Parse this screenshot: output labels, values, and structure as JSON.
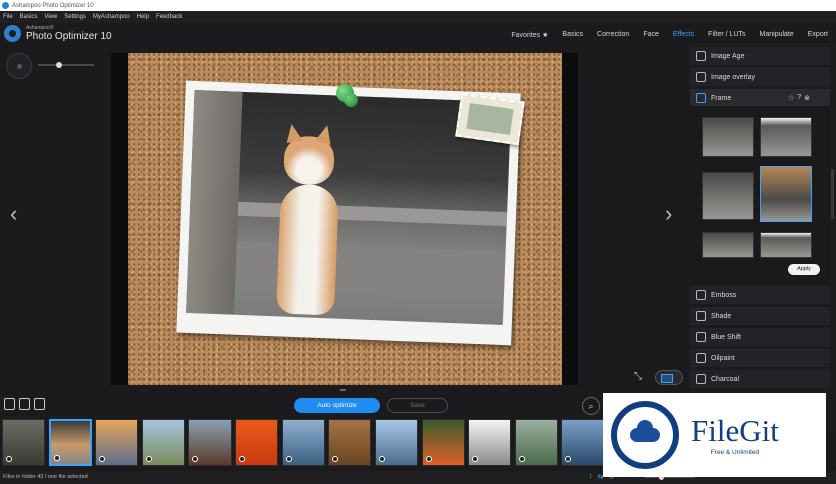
{
  "window": {
    "title": "Ashampoo Photo Optimizer 10"
  },
  "menu": [
    "File",
    "Basics",
    "View",
    "Settings",
    "MyAshampoo",
    "Help",
    "Feedback"
  ],
  "logo": {
    "brand": "Ashampoo®",
    "product": "Photo Optimizer 10"
  },
  "nav": {
    "items": [
      "Favorites ★",
      "Basics",
      "Correction",
      "Face",
      "Effects",
      "Filter / LUTs",
      "Manipulate",
      "Export"
    ],
    "active": "Effects"
  },
  "effects_panel": {
    "items_top": [
      "Image Age",
      "Image overlay"
    ],
    "selected": "Frame",
    "frame_actions": [
      "☆",
      "?",
      "⊗"
    ],
    "apply_label": "Apply",
    "items_bottom": [
      "Emboss",
      "Shade",
      "Blue Shift",
      "Oilpaint",
      "Charcoal"
    ]
  },
  "toolbar": {
    "auto_optimize_label": "Auto optimize",
    "save_label": "Save"
  },
  "filmstrip": {
    "count": 13,
    "selected_index": 1
  },
  "status": {
    "text": "Files in folder 43 / one file selected"
  },
  "watermark": {
    "title": "FileGit",
    "subtitle": "Free & Unlimited"
  },
  "colors": {
    "accent": "#3ea0ff",
    "button_blue": "#1e8cf2",
    "background": "#1b1b1d",
    "watermark_blue": "#0f3f80"
  }
}
